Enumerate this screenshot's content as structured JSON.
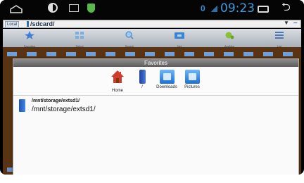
{
  "status_bar": {
    "notification_count": "0",
    "time": "09:23"
  },
  "path_bar": {
    "location_chip": "Local",
    "path": "/sdcard/"
  },
  "toolbar": {
    "items": [
      {
        "label": "Favorites",
        "icon": "star-icon",
        "color": "#3f7fd6"
      },
      {
        "label": "Select",
        "icon": "grid-icon",
        "color": "#7ab0e0"
      },
      {
        "label": "Search",
        "icon": "search-icon",
        "color": "#4e8fcf"
      },
      {
        "label": "Net",
        "icon": "network-folder-icon",
        "color": "#3c82d4"
      },
      {
        "label": "AppMgr",
        "icon": "app-manager-icon",
        "color": "#8bbf3a"
      },
      {
        "label": "List",
        "icon": "list-icon",
        "color": "#4d78b8"
      }
    ]
  },
  "dialog": {
    "title": "Favorites",
    "favorites": [
      {
        "label": "Home",
        "icon": "home-icon"
      },
      {
        "label": "/",
        "icon": "phone-icon"
      },
      {
        "label": "Downloads",
        "icon": "folder-icon"
      },
      {
        "label": "Pictures",
        "icon": "folder-icon"
      }
    ],
    "entries": [
      {
        "name": "/mnt/storage/extsd1/",
        "path": "/mnt/storage/extsd1/",
        "icon": "sd-card-icon"
      }
    ]
  }
}
